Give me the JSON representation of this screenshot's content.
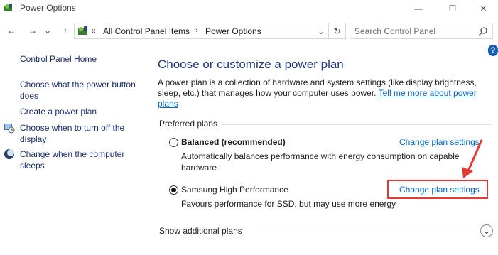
{
  "window": {
    "title": "Power Options",
    "minimize_glyph": "—",
    "maximize_glyph": "☐",
    "close_glyph": "✕"
  },
  "nav": {
    "back_glyph": "←",
    "forward_glyph": "→",
    "recent_glyph": "⌄",
    "up_glyph": "↑",
    "breadcrumb_prefix": "«",
    "breadcrumbs": [
      "All Control Panel Items",
      "Power Options"
    ],
    "breadcrumb_separator": "›",
    "refresh_glyph": "↻",
    "dropdown_glyph": "⌄"
  },
  "search": {
    "placeholder": "Search Control Panel"
  },
  "help": {
    "label": "?"
  },
  "sidebar": {
    "home": "Control Panel Home",
    "links": [
      "Choose what the power button does",
      "Create a power plan",
      "Choose when to turn off the display",
      "Change when the computer sleeps"
    ]
  },
  "main": {
    "title": "Choose or customize a power plan",
    "description": "A power plan is a collection of hardware and system settings (like display brightness, sleep, etc.) that manages how your computer uses power.",
    "learn_more": "Tell me more about power plans",
    "preferred_heading": "Preferred plans",
    "plans": [
      {
        "name": "Balanced (recommended)",
        "description": "Automatically balances performance with energy consumption on capable hardware.",
        "change_link": "Change plan settings",
        "selected": false
      },
      {
        "name": "Samsung High Performance",
        "description": "Favours performance for SSD, but may use more energy",
        "change_link": "Change plan settings",
        "selected": true
      }
    ],
    "show_more": "Show additional plans",
    "show_more_glyph": "⌄"
  },
  "colors": {
    "link": "#0066cc",
    "sidebar_link": "#1a2f6e",
    "title": "#1e3a78",
    "annotation": "#e53935"
  }
}
